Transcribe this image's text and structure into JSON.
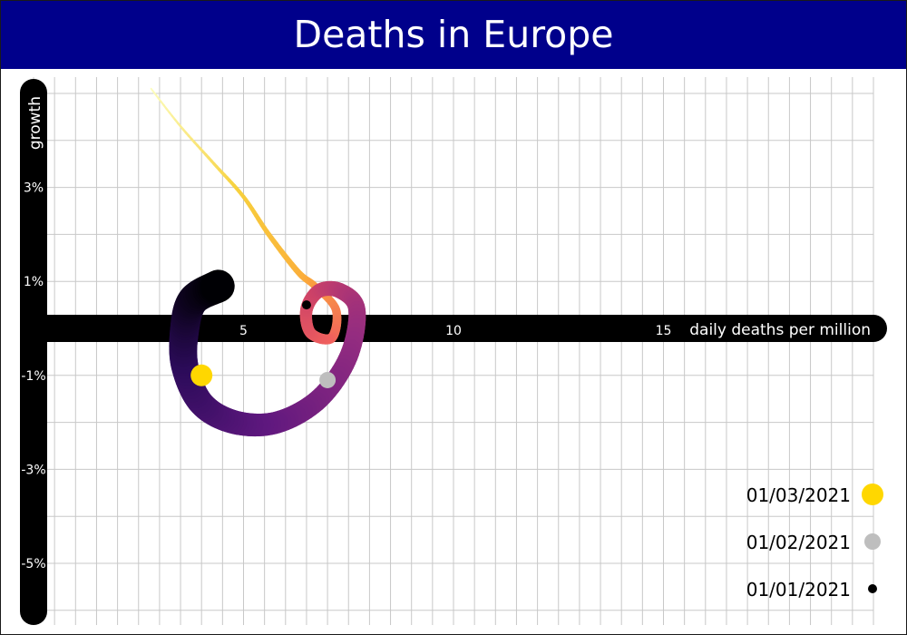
{
  "title": "Deaths in Europe",
  "colors": {
    "title_background": "#00008b",
    "axis_bar": "#000000",
    "grid": "#c8c8c8",
    "path_gradient": [
      "#000004",
      "#2c0b5a",
      "#5f187f",
      "#942c80",
      "#cb4168",
      "#f1605d",
      "#fbab3a",
      "#f7d13d",
      "#fcfdbf"
    ]
  },
  "chart_data": {
    "type": "line",
    "title": "Deaths in Europe",
    "xlabel": "daily deaths per million",
    "ylabel": "growth",
    "x_ticks": [
      {
        "value": 5,
        "label": "5"
      },
      {
        "value": 10,
        "label": "10"
      },
      {
        "value": 15,
        "label": "15"
      }
    ],
    "y_ticks": [
      {
        "value": 3,
        "label": "3%"
      },
      {
        "value": 1,
        "label": "1%"
      },
      {
        "value": -1,
        "label": "-1%"
      },
      {
        "value": -3,
        "label": "-3%"
      },
      {
        "value": -5,
        "label": "-5%"
      }
    ],
    "xlim": [
      0,
      20.3
    ],
    "ylim": [
      -6.3,
      5.1
    ],
    "grid": true,
    "legend_position": "bottom-right",
    "points": [
      {
        "x": 2.8,
        "y": 5.1
      },
      {
        "x": 3.5,
        "y": 4.3
      },
      {
        "x": 4.3,
        "y": 3.5
      },
      {
        "x": 5.0,
        "y": 2.8
      },
      {
        "x": 5.6,
        "y": 2.0
      },
      {
        "x": 6.3,
        "y": 1.2
      },
      {
        "x": 6.7,
        "y": 0.9
      },
      {
        "x": 7.2,
        "y": 0.4
      },
      {
        "x": 7.1,
        "y": -0.2
      },
      {
        "x": 6.6,
        "y": -0.1
      },
      {
        "x": 6.5,
        "y": 0.4
      },
      {
        "x": 6.8,
        "y": 0.8
      },
      {
        "x": 7.3,
        "y": 0.8
      },
      {
        "x": 7.7,
        "y": 0.4
      },
      {
        "x": 7.5,
        "y": -0.6
      },
      {
        "x": 6.8,
        "y": -1.5
      },
      {
        "x": 5.8,
        "y": -2.0
      },
      {
        "x": 4.8,
        "y": -2.0
      },
      {
        "x": 4.0,
        "y": -1.6
      },
      {
        "x": 3.6,
        "y": -0.8
      },
      {
        "x": 3.6,
        "y": 0.0
      },
      {
        "x": 3.8,
        "y": 0.6
      },
      {
        "x": 4.4,
        "y": 0.9
      }
    ],
    "markers": [
      {
        "label": "01/03/2021",
        "x": 4.0,
        "y": -1.0,
        "color": "#ffd700",
        "size": "large"
      },
      {
        "label": "01/02/2021",
        "x": 7.0,
        "y": -1.1,
        "color": "#bebebe",
        "size": "medium"
      },
      {
        "label": "01/01/2021",
        "x": 6.5,
        "y": 0.5,
        "color": "#000000",
        "size": "small"
      }
    ]
  }
}
